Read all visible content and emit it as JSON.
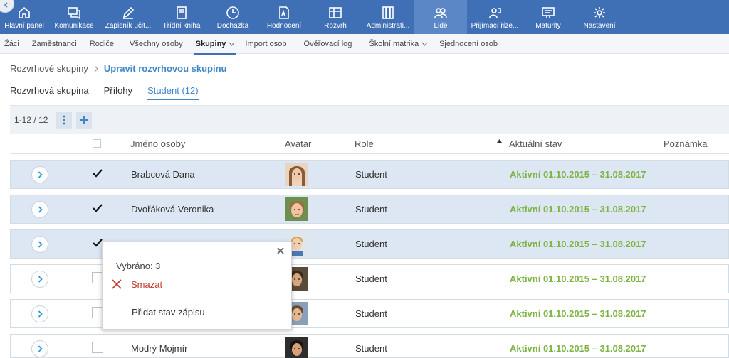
{
  "nav": {
    "items": [
      {
        "label": "Hlavní panel",
        "icon": "home-icon"
      },
      {
        "label": "Komunikace",
        "icon": "chat-icon"
      },
      {
        "label": "Zápisník učit...",
        "icon": "pencil-icon"
      },
      {
        "label": "Třídní kniha",
        "icon": "book-icon"
      },
      {
        "label": "Docházka",
        "icon": "clock-icon"
      },
      {
        "label": "Hodnocení",
        "icon": "grade-icon"
      },
      {
        "label": "Rozvrh",
        "icon": "timetable-icon"
      },
      {
        "label": "Administrati...",
        "icon": "admin-icon"
      },
      {
        "label": "Lidé",
        "icon": "people-icon"
      },
      {
        "label": "Přijímací říze...",
        "icon": "admission-icon"
      },
      {
        "label": "Maturity",
        "icon": "maturity-icon"
      },
      {
        "label": "Nastavení",
        "icon": "gear-icon"
      }
    ],
    "active_index": 8
  },
  "subnav": {
    "items": [
      {
        "label": "Žáci"
      },
      {
        "label": "Zaměstnanci"
      },
      {
        "label": "Rodiče"
      },
      {
        "label": "Všechny osoby"
      },
      {
        "label": "Skupiny"
      },
      {
        "label": "Import osob"
      },
      {
        "label": "Ověřovací log"
      },
      {
        "label": "Školní matrika"
      },
      {
        "label": "Sjednocení osob"
      }
    ]
  },
  "breadcrumb": {
    "root": "Rozvrhové skupiny",
    "current": "Upravit rozvrhovou skupinu"
  },
  "tabs": {
    "items": [
      {
        "label": "Rozvrhová skupina"
      },
      {
        "label": "Přílohy"
      },
      {
        "label": "Student (12)"
      }
    ]
  },
  "toolbar": {
    "count": "1-12 / 12"
  },
  "table": {
    "headers": {
      "name": "Jméno osoby",
      "avatar": "Avatar",
      "role": "Role",
      "state": "Aktuální stav",
      "note": "Poznámka"
    },
    "rows": [
      {
        "name": "Brabcová Dana",
        "role": "Student",
        "state": "Aktivní 01.10.2015 – 31.08.2017",
        "selected": true
      },
      {
        "name": "Dvořáková Veronika",
        "role": "Student",
        "state": "Aktivní 01.10.2015 – 31.08.2017",
        "selected": true
      },
      {
        "name": "",
        "role": "Student",
        "state": "Aktivní 01.10.2015 – 31.08.2017",
        "selected": true
      },
      {
        "name": "",
        "role": "Student",
        "state": "Aktivní 01.10.2015 – 31.08.2017",
        "selected": false
      },
      {
        "name": "",
        "role": "Student",
        "state": "Aktivní 01.10.2015 – 31.08.2017",
        "selected": false
      },
      {
        "name": "Modrý Mojmír",
        "role": "Student",
        "state": "Aktivní 01.10.2015 – 31.08.2017",
        "selected": false
      }
    ]
  },
  "popup": {
    "selected_info": "Vybráno: 3",
    "delete_label": "Smazat",
    "add_state_label": "Přidat stav zápisu"
  },
  "colors": {
    "nav_bg": "#3f6fb5",
    "nav_active": "#5b87c6",
    "link_blue": "#3f87c9",
    "state_green": "#7cb342",
    "delete_red": "#c0392b",
    "selected_row": "#dde7f3"
  }
}
